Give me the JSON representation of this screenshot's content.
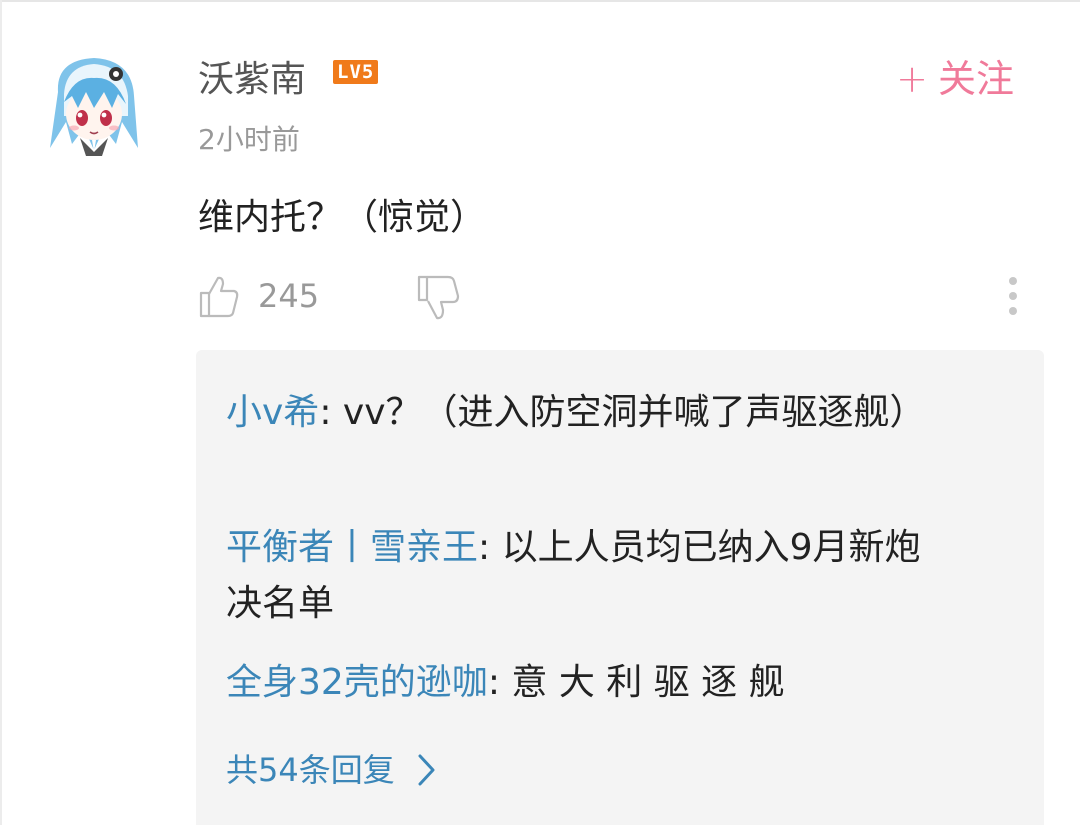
{
  "comment": {
    "username": "沃紫南",
    "level": "LV5",
    "follow_label": "关注",
    "follow_plus": "+",
    "time": "2小时前",
    "text": "维内托？（惊觉）",
    "likes": "245",
    "icons": [
      "avatar",
      "thumbs-up-icon",
      "thumbs-down-icon",
      "more-vertical-icon"
    ]
  },
  "replies": [
    {
      "author": "小v希",
      "separator": ": ",
      "text": "vv？（进入防空洞并喊了声驱逐舰）"
    },
    {
      "author": "平衡者丨雪亲王",
      "separator": ": ",
      "text": "以上人员均已纳入9月新炮决名单"
    },
    {
      "author": "全身32壳的逊咖",
      "separator": ": ",
      "text": "意 大 利 驱 逐 舰"
    }
  ],
  "more_replies": {
    "label": "共54条回复",
    "icon": "chevron-right-icon"
  },
  "colors": {
    "link_blue": "#3b86b8",
    "follow_pink": "#f07a9a",
    "level_orange": "#f07a1a",
    "reply_bg": "#f4f4f4"
  }
}
